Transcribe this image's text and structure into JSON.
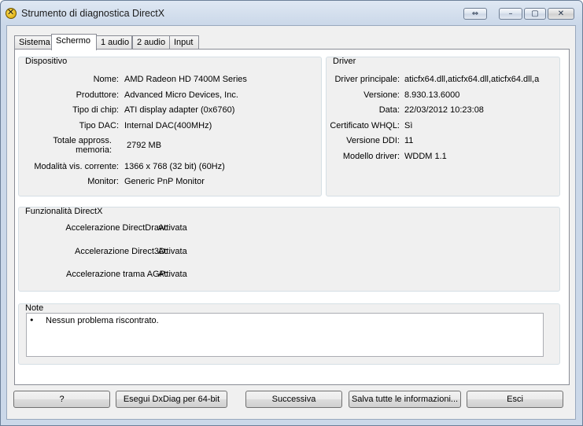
{
  "window": {
    "title": "Strumento di diagnostica DirectX",
    "controls": {
      "extra": "⇔",
      "minimize": "–",
      "maximize": "▢",
      "close": "✕"
    }
  },
  "tabs": [
    {
      "label": "Sistema",
      "active": false
    },
    {
      "label": "Schermo",
      "active": true
    },
    {
      "label": "1 audio",
      "active": false
    },
    {
      "label": "2 audio",
      "active": false
    },
    {
      "label": "Input",
      "active": false
    }
  ],
  "device": {
    "title": "Dispositivo",
    "rows": [
      {
        "label": "Nome:",
        "value": "AMD Radeon HD 7400M Series"
      },
      {
        "label": "Produttore:",
        "value": "Advanced Micro Devices, Inc."
      },
      {
        "label": "Tipo di chip:",
        "value": "ATI display adapter (0x6760)"
      },
      {
        "label": "Tipo DAC:",
        "value": "Internal DAC(400MHz)"
      },
      {
        "label": "Totale appross. memoria:",
        "value": "2792 MB"
      },
      {
        "label": "Modalità vis. corrente:",
        "value": "1366 x 768 (32 bit) (60Hz)"
      },
      {
        "label": "Monitor:",
        "value": "Generic PnP Monitor"
      }
    ]
  },
  "driver": {
    "title": "Driver",
    "rows": [
      {
        "label": "Driver principale:",
        "value": "aticfx64.dll,aticfx64.dll,aticfx64.dll,a"
      },
      {
        "label": "Versione:",
        "value": "8.930.13.6000"
      },
      {
        "label": "Data:",
        "value": "22/03/2012 10:23:08"
      },
      {
        "label": "Certificato WHQL:",
        "value": "Sì"
      },
      {
        "label": "Versione DDI:",
        "value": "11"
      },
      {
        "label": "Modello driver:",
        "value": "WDDM 1.1"
      }
    ]
  },
  "features": {
    "title": "Funzionalità DirectX",
    "rows": [
      {
        "label": "Accelerazione DirectDraw:",
        "value": "Attivata"
      },
      {
        "label": "Accelerazione Direct3D:",
        "value": "Attivata"
      },
      {
        "label": "Accelerazione trama AGP:",
        "value": "Attivata"
      }
    ]
  },
  "notes": {
    "title": "Note",
    "bullet": "•",
    "text": "Nessun problema riscontrato."
  },
  "buttons": {
    "help": "?",
    "dxdiag64": "Esegui DxDiag per 64-bit",
    "next": "Successiva",
    "save_all": "Salva tutte le informazioni...",
    "exit": "Esci"
  }
}
